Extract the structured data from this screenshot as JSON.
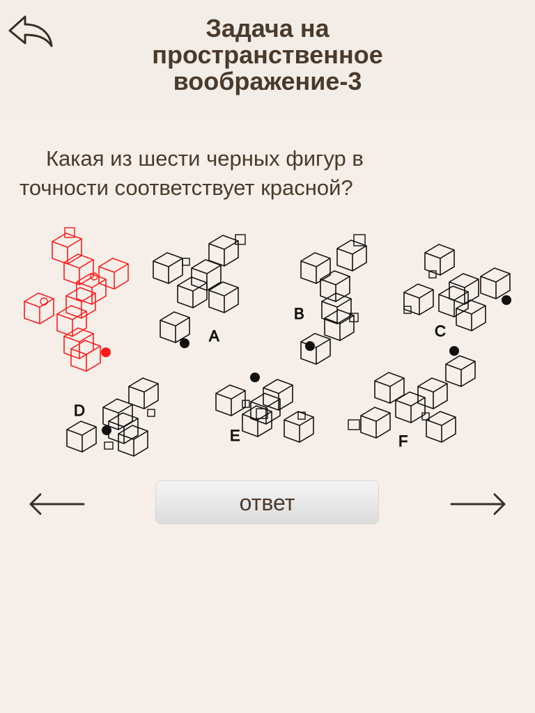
{
  "header": {
    "title": "Задача на пространственное воображение-3",
    "back_icon": "back-arrow-icon"
  },
  "question": {
    "text": "Какая из шести черных фигур в точности соответствует красной?"
  },
  "figures": {
    "reference_color": "#ff0000",
    "option_color": "#111111",
    "options": [
      "A",
      "B",
      "C",
      "D",
      "E",
      "F"
    ]
  },
  "footer": {
    "prev_icon": "arrow-left-icon",
    "answer_label": "ответ",
    "next_icon": "arrow-right-icon"
  }
}
